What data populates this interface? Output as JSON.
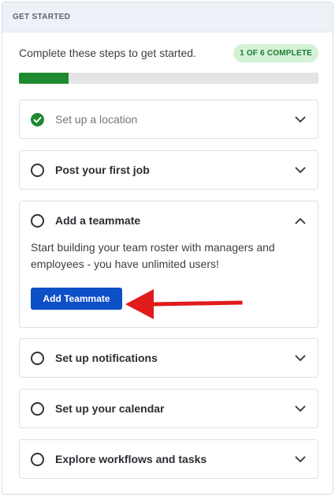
{
  "header": {
    "title": "GET STARTED"
  },
  "intro": {
    "text": "Complete these steps to get started.",
    "badge": "1 OF 6 COMPLETE"
  },
  "progress": {
    "completed": 1,
    "total": 6,
    "fraction": 0.167
  },
  "steps": [
    {
      "label": "Set up a location",
      "status": "complete",
      "expanded": false
    },
    {
      "label": "Post your first job",
      "status": "incomplete",
      "expanded": false
    },
    {
      "label": "Add a teammate",
      "status": "incomplete",
      "expanded": true,
      "description": "Start building your team roster with managers and employees - you have unlimited users!",
      "button_label": "Add Teammate"
    },
    {
      "label": "Set up notifications",
      "status": "incomplete",
      "expanded": false
    },
    {
      "label": "Set up your calendar",
      "status": "incomplete",
      "expanded": false
    },
    {
      "label": "Explore workflows and tasks",
      "status": "incomplete",
      "expanded": false
    }
  ],
  "colors": {
    "progress_fill": "#1e8a2f",
    "badge_bg": "#d3f2d6",
    "button_bg": "#0d4fc7",
    "check": "#1e8a2f",
    "annotation_arrow": "#e01b1b"
  },
  "icons": {
    "check": "check-circle-icon",
    "incomplete": "empty-circle-icon",
    "collapsed": "chevron-down-icon",
    "expanded": "chevron-up-icon"
  }
}
